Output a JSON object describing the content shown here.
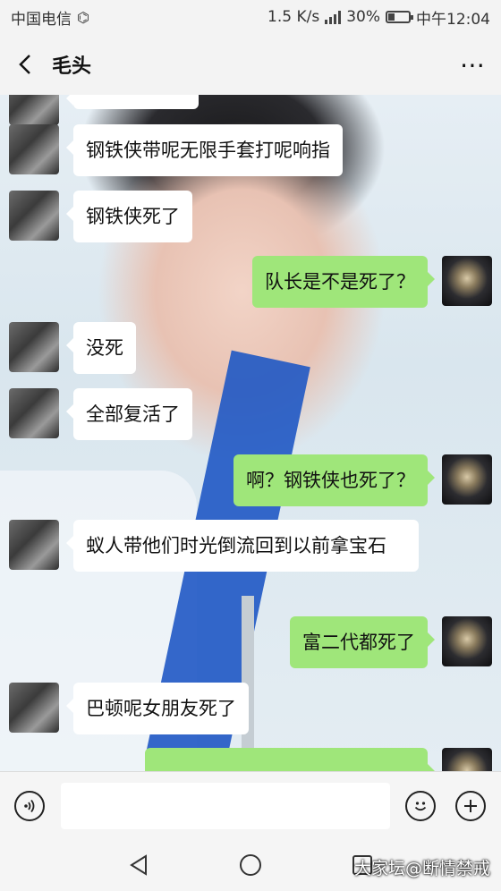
{
  "status": {
    "carrier": "中国电信",
    "speed": "1.5 K/s",
    "battery": "30%",
    "battery_level": 0.3,
    "time": "中午12:04"
  },
  "header": {
    "title": "毛头"
  },
  "messages": [
    {
      "from": "friend",
      "text": "钢铁侠带呢无限手套打呢响指"
    },
    {
      "from": "friend",
      "text": "钢铁侠死了"
    },
    {
      "from": "me",
      "text": "队长是不是死了？"
    },
    {
      "from": "friend",
      "text": "没死"
    },
    {
      "from": "friend",
      "text": "全部复活了"
    },
    {
      "from": "me",
      "text": "啊？钢铁侠也死了？"
    },
    {
      "from": "friend",
      "text": "蚁人带他们时光倒流回到以前拿宝石"
    },
    {
      "from": "me",
      "text": "富二代都死了"
    },
    {
      "from": "friend",
      "text": "巴顿呢女朋友死了"
    }
  ],
  "watermark": "大家坛@断情禁戒"
}
